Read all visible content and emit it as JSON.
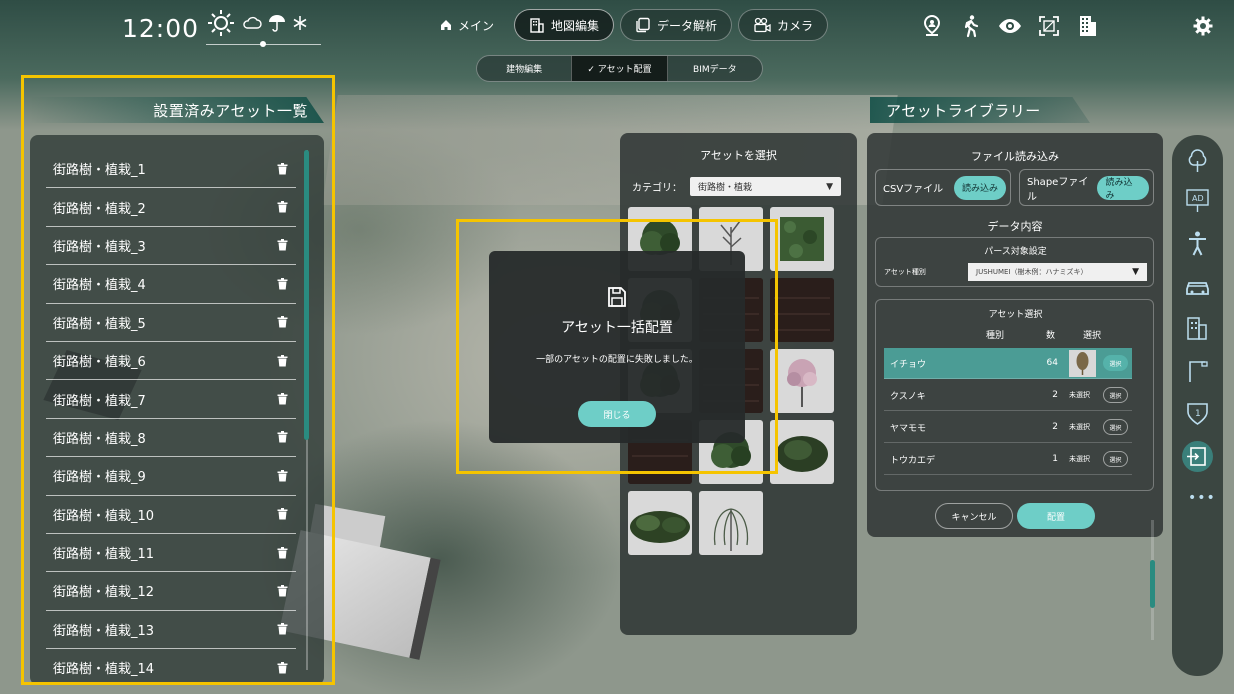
{
  "clock": "12:00",
  "weather": {
    "icons": [
      "sun-icon",
      "cloud-icon",
      "umbrella-icon",
      "snowflake-icon"
    ]
  },
  "nav": {
    "tabs": [
      {
        "label": "メイン",
        "icon": "home-icon"
      },
      {
        "label": "地図編集",
        "icon": "building-icon"
      },
      {
        "label": "データ解析",
        "icon": "copy-icon"
      },
      {
        "label": "カメラ",
        "icon": "camera-icon"
      }
    ],
    "active": "地図編集"
  },
  "top_icons": [
    "location-person-icon",
    "walking-icon",
    "eye-icon",
    "scan-icon",
    "building-grid-icon",
    "gear-icon"
  ],
  "subtabs": [
    {
      "label": "建物編集"
    },
    {
      "label": "✓ アセット配置"
    },
    {
      "label": "BIMデータ"
    }
  ],
  "left_panel": {
    "title": "設置済みアセット一覧",
    "items": [
      "街路樹・植栽_1",
      "街路樹・植栽_2",
      "街路樹・植栽_3",
      "街路樹・植栽_4",
      "街路樹・植栽_5",
      "街路樹・植栽_6",
      "街路樹・植栽_7",
      "街路樹・植栽_8",
      "街路樹・植栽_9",
      "街路樹・植栽_10",
      "街路樹・植栽_11",
      "街路樹・植栽_12",
      "街路樹・植栽_13",
      "街路樹・植栽_14"
    ]
  },
  "asset_select": {
    "title": "アセットを選択",
    "category_label": "カテゴリ：",
    "category_value": "街路樹・植栽",
    "tiles": [
      "tree-icon",
      "bare-tree-icon",
      "hedge-icon",
      "tree-icon",
      "dark-box-icon",
      "dark-box-icon",
      "tree-icon",
      "dark-box-icon",
      "blossom-tree-icon",
      "dark-box-icon",
      "tree-icon",
      "bush-icon",
      "shrub-icon",
      "willow-icon"
    ]
  },
  "modal": {
    "title": "アセット一括配置",
    "message": "一部のアセットの配置に失敗しました。",
    "close_label": "閉じる"
  },
  "library": {
    "title": "アセットライブラリー",
    "file_section": "ファイル読み込み",
    "csv_label": "CSVファイル",
    "shape_label": "Shapeファイル",
    "read_label": "読み込み",
    "data_section": "データ内容",
    "parse_title": "パース対象設定",
    "parse_label": "アセット種別",
    "parse_value": "JUSHUMEI（樹木例：ハナミズキ）",
    "asset_select_title": "アセット選択",
    "col_type": "種別",
    "col_count": "数",
    "col_select": "選択",
    "rows": [
      {
        "name": "イチョウ",
        "count": "64",
        "status": "",
        "pick": "選択"
      },
      {
        "name": "クスノキ",
        "count": "2",
        "status": "未選択",
        "pick": "選択"
      },
      {
        "name": "ヤマモモ",
        "count": "2",
        "status": "未選択",
        "pick": "選択"
      },
      {
        "name": "トウカエデ",
        "count": "1",
        "status": "未選択",
        "pick": "選択"
      }
    ],
    "cancel_label": "キャンセル",
    "place_label": "配置"
  },
  "sidebar": {
    "icons": [
      "tree-outline-icon",
      "ad-sign-icon",
      "person-icon",
      "car-icon",
      "building-icon",
      "street-light-icon",
      "route-sign-icon",
      "import-icon"
    ],
    "active": "import-icon",
    "more": "•••"
  },
  "colors": {
    "accent": "#6ecec7",
    "highlight": "#f5c400",
    "panel": "#2f3a38",
    "selected_row": "#4b9c95"
  }
}
